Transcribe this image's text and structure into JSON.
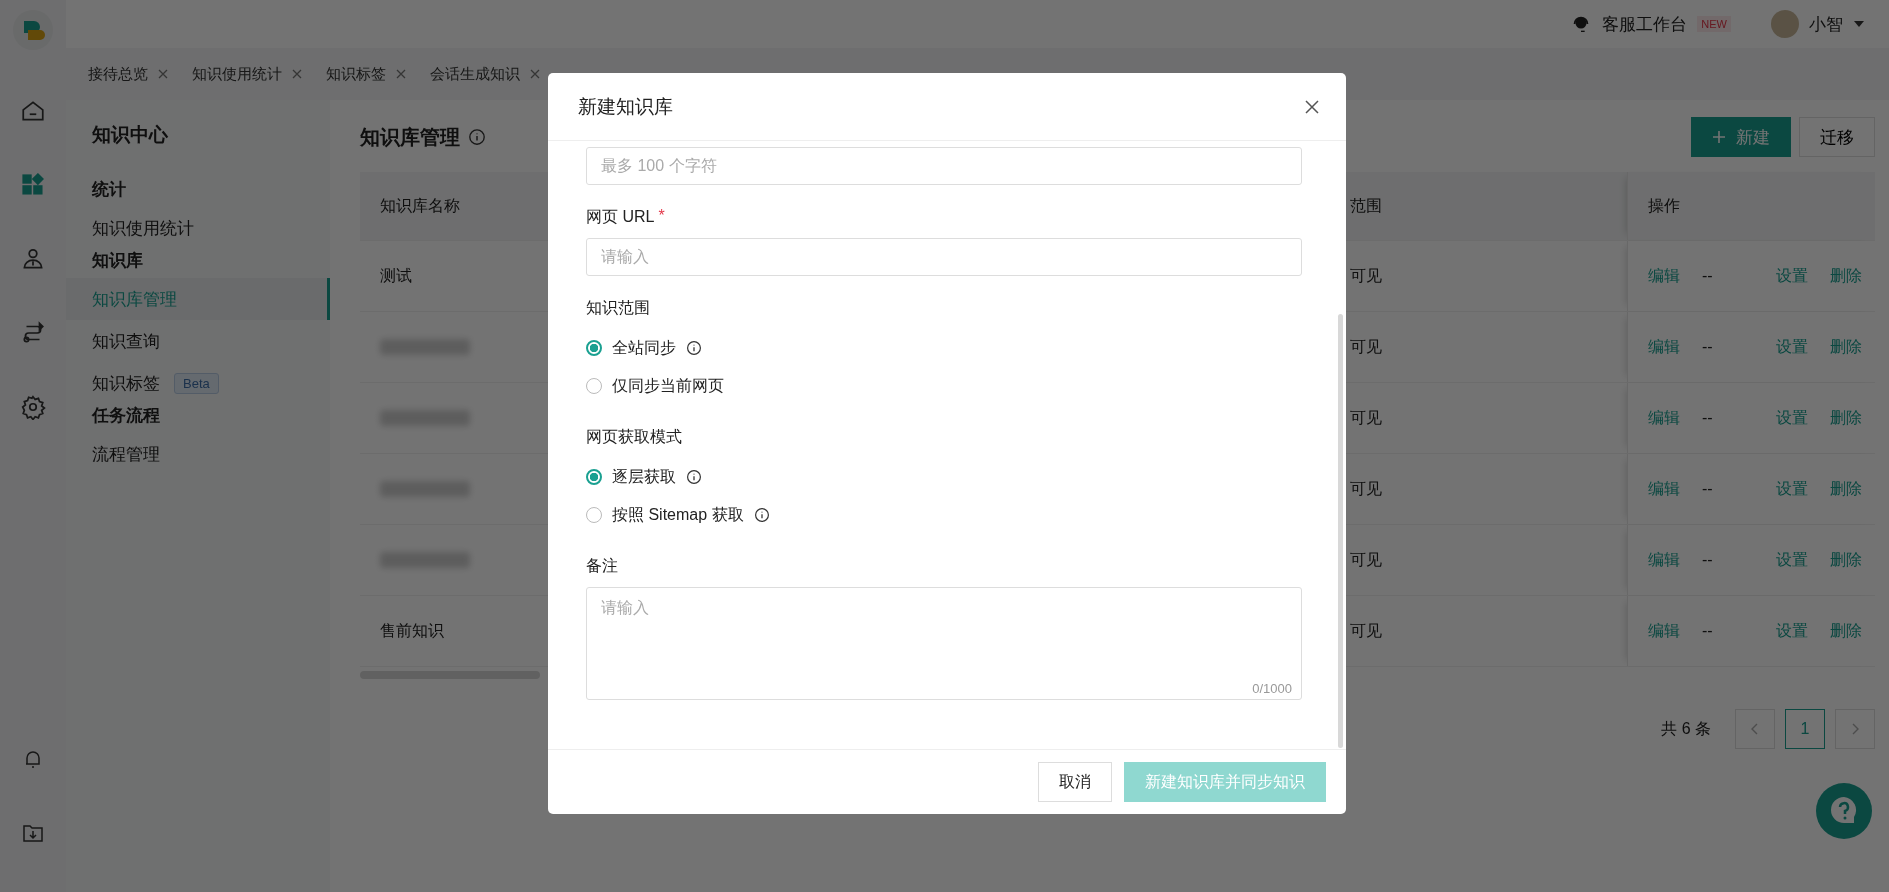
{
  "top_bar": {
    "workbench_label": "客服工作台",
    "badge": "NEW",
    "user_name": "小智"
  },
  "rail": [
    {
      "kind": "home",
      "selected": false
    },
    {
      "kind": "apps",
      "selected": true
    },
    {
      "kind": "person",
      "selected": false
    },
    {
      "kind": "flow",
      "selected": false
    },
    {
      "kind": "settings",
      "selected": false
    }
  ],
  "rail_bottom": [
    {
      "kind": "bell"
    },
    {
      "kind": "folder-download"
    }
  ],
  "tabs": [
    {
      "label": "接待总览"
    },
    {
      "label": "知识使用统计"
    },
    {
      "label": "知识标签"
    },
    {
      "label": "会话生成知识"
    }
  ],
  "sidebar": {
    "title": "知识中心",
    "groups": [
      {
        "heading": "统计",
        "items": [
          {
            "label": "知识使用统计",
            "selected": false
          }
        ]
      },
      {
        "heading": "知识库",
        "items": [
          {
            "label": "知识库管理",
            "selected": true
          },
          {
            "label": "知识查询",
            "selected": false
          },
          {
            "label": "知识标签",
            "selected": false,
            "badge": "Beta"
          }
        ]
      },
      {
        "heading": "任务流程",
        "items": [
          {
            "label": "流程管理",
            "selected": false
          }
        ]
      }
    ]
  },
  "page": {
    "title": "知识库管理",
    "buttons": [
      {
        "label": "新建",
        "kind": "primary"
      },
      {
        "label": "迁移",
        "kind": "default"
      }
    ]
  },
  "table": {
    "columns": [
      "知识库名称",
      "范围",
      "操作"
    ],
    "rows": [
      {
        "name": "测试",
        "redacted": false,
        "scope": "可见",
        "actions": [
          {
            "label": "编辑",
            "kind": "link"
          },
          {
            "label": "--",
            "kind": "text"
          },
          {
            "label": "设置",
            "kind": "link"
          },
          {
            "label": "删除",
            "kind": "link"
          }
        ]
      },
      {
        "redacted": true,
        "scope": "可见",
        "actions": [
          {
            "label": "编辑",
            "kind": "link"
          },
          {
            "label": "--",
            "kind": "text"
          },
          {
            "label": "设置",
            "kind": "link"
          },
          {
            "label": "删除",
            "kind": "link"
          }
        ]
      },
      {
        "redacted": true,
        "scope": "可见",
        "actions": [
          {
            "label": "编辑",
            "kind": "link"
          },
          {
            "label": "--",
            "kind": "text"
          },
          {
            "label": "设置",
            "kind": "link"
          },
          {
            "label": "删除",
            "kind": "link"
          }
        ]
      },
      {
        "redacted": true,
        "scope": "可见",
        "actions": [
          {
            "label": "编辑",
            "kind": "link"
          },
          {
            "label": "--",
            "kind": "text"
          },
          {
            "label": "设置",
            "kind": "link"
          },
          {
            "label": "删除",
            "kind": "link"
          }
        ]
      },
      {
        "redacted": true,
        "scope": "可见",
        "actions": [
          {
            "label": "编辑",
            "kind": "link"
          },
          {
            "label": "--",
            "kind": "text"
          },
          {
            "label": "设置",
            "kind": "link"
          },
          {
            "label": "删除",
            "kind": "link"
          }
        ]
      },
      {
        "name": "售前知识",
        "redacted": false,
        "scope": "可见",
        "actions": [
          {
            "label": "编辑",
            "kind": "link"
          },
          {
            "label": "--",
            "kind": "text"
          },
          {
            "label": "设置",
            "kind": "link"
          },
          {
            "label": "删除",
            "kind": "link"
          }
        ]
      }
    ]
  },
  "pagination": {
    "total": "共 6 条",
    "pages": [
      {
        "label": "1",
        "selected": true
      }
    ]
  },
  "dialog": {
    "title": "新建知识库",
    "fields": [
      {
        "kind": "input",
        "placeholder": "最多 100 个字符"
      },
      {
        "kind": "input",
        "label": "网页 URL",
        "required_mark": "*",
        "placeholder": "请输入"
      },
      {
        "kind": "radio",
        "label": "知识范围",
        "options": [
          {
            "label": "全站同步",
            "selected": true,
            "info": true
          },
          {
            "label": "仅同步当前网页",
            "selected": false,
            "info": false
          }
        ]
      },
      {
        "kind": "radio",
        "label": "网页获取模式",
        "options": [
          {
            "label": "逐层获取",
            "selected": true,
            "info": true
          },
          {
            "label": "按照 Sitemap 获取",
            "selected": false,
            "info": true
          }
        ]
      },
      {
        "kind": "textarea",
        "label": "备注",
        "placeholder": "请输入",
        "counter": "0/1000"
      }
    ],
    "buttons": [
      {
        "label": "取消",
        "kind": "default",
        "disabled": false
      },
      {
        "label": "新建知识库并同步知识",
        "kind": "primary",
        "disabled": true
      }
    ]
  }
}
